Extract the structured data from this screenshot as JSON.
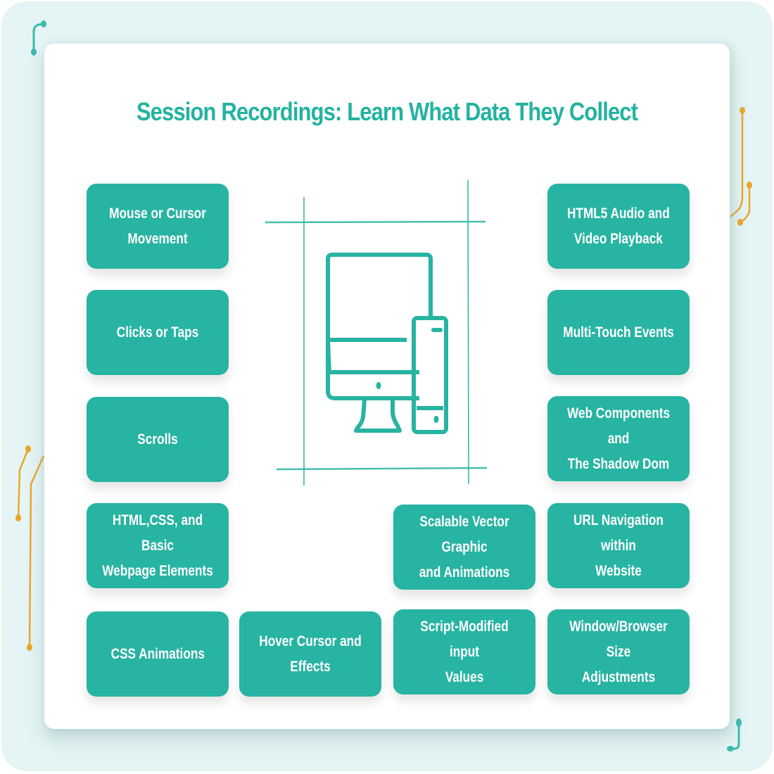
{
  "title": "Session Recordings: Learn What Data They Collect",
  "colors": {
    "accent": "#27b4a2",
    "title": "#23b3a0",
    "background": "#e5f4f4",
    "decoration_orange": "#eba62a",
    "decoration_teal": "#3bbcae"
  },
  "center_icon": "desktop-and-mobile-devices-icon",
  "cards": [
    {
      "label": "Mouse or Cursor\nMovement"
    },
    {
      "label": "Clicks or Taps"
    },
    {
      "label": "Scrolls"
    },
    {
      "label": "HTML,CSS, and Basic\nWebpage Elements"
    },
    {
      "label": "CSS Animations"
    },
    {
      "label": "Hover Cursor and Effects"
    },
    {
      "label": "Scalable Vector Graphic\nand Animations"
    },
    {
      "label": "Script-Modified input\nValues"
    },
    {
      "label": "HTML5 Audio and\nVideo Playback"
    },
    {
      "label": "Multi-Touch Events"
    },
    {
      "label": "Web Components and\nThe Shadow Dom"
    },
    {
      "label": "URL Navigation within\nWebsite"
    },
    {
      "label": "Window/Browser Size\nAdjustments"
    }
  ]
}
